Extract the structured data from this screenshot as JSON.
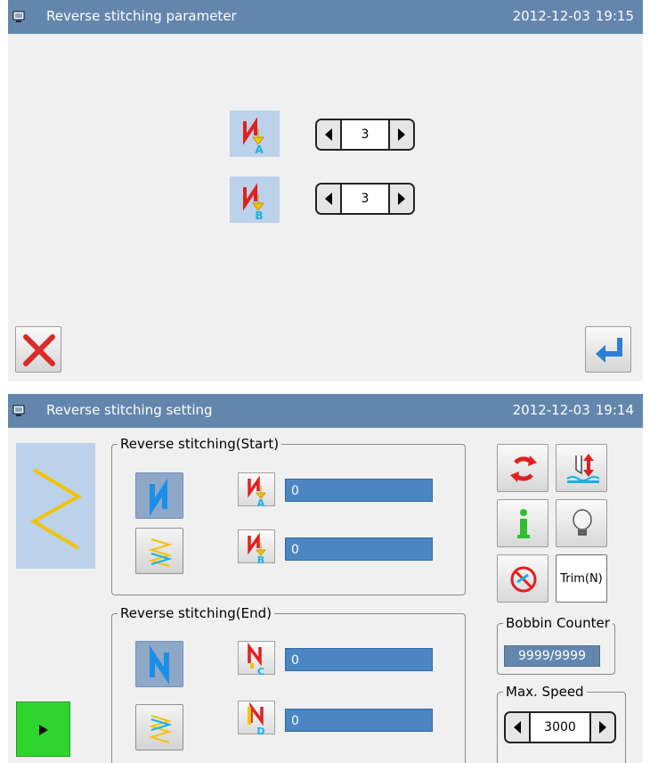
{
  "screen1": {
    "title": "Reverse stitching parameter",
    "date": "2012-12-03",
    "time": "19:15",
    "param_a": {
      "icon_letter": "A",
      "value": "3"
    },
    "param_b": {
      "icon_letter": "B",
      "value": "3"
    }
  },
  "screen2": {
    "title": "Reverse stitching setting",
    "date": "2012-12-03",
    "time": "19:14",
    "start_group": {
      "label": "Reverse stitching(Start)",
      "param_a": {
        "icon_letter": "A",
        "value": "0"
      },
      "param_b": {
        "icon_letter": "B",
        "value": "0"
      }
    },
    "end_group": {
      "label": "Reverse stitching(End)",
      "param_c": {
        "icon_letter": "C",
        "value": "0"
      },
      "param_d": {
        "icon_letter": "D",
        "value": "0"
      }
    },
    "trim_label": "Trim(N)",
    "bobbin_counter": {
      "label": "Bobbin Counter",
      "value": "9999/9999"
    },
    "max_speed": {
      "label": "Max. Speed",
      "value": "3000"
    }
  },
  "colors": {
    "titlebar": "#6386ad",
    "panel_bg": "#f0f0f0",
    "value_bar": "#4b86c2",
    "cancel_red": "#d92b2b",
    "enter_blue": "#2a7fd4",
    "play_green": "#2fd42f",
    "zigzag_yellow": "#f2c40a"
  },
  "icons": [
    "monitor-icon",
    "param-a-icon",
    "param-b-icon",
    "param-c-icon",
    "param-d-icon",
    "cancel-icon",
    "enter-icon",
    "cycle-icon",
    "needle-up-icon",
    "info-icon",
    "lightbulb-icon",
    "no-thread-icon",
    "play-icon"
  ]
}
